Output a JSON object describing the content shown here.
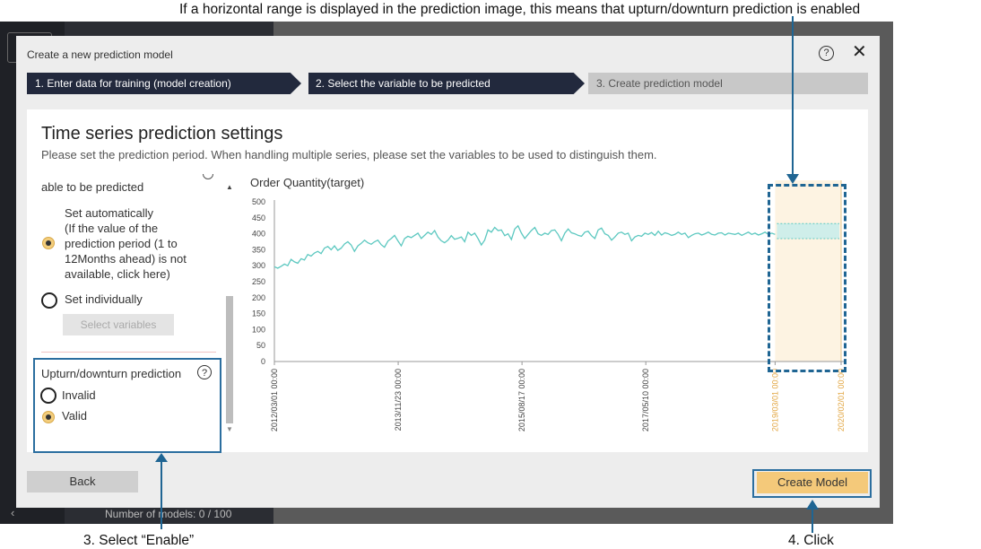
{
  "annotations": {
    "top_note": "If a horizontal range is displayed in the prediction image, this means that upturn/downturn prediction is enabled",
    "step3_caption": "3. Select “Enable”",
    "step4_caption": "4. Click"
  },
  "background": {
    "model_count": "Number of models: 0 / 100"
  },
  "dialog": {
    "title": "Create a new prediction model",
    "help_icon": "?",
    "close_icon": "✕",
    "steps": [
      {
        "label": "1. Enter data for training (model creation)",
        "state": "done"
      },
      {
        "label": "2. Select the variable to be predicted",
        "state": "current"
      },
      {
        "label": "3. Create prediction model",
        "state": "pending"
      }
    ],
    "panel": {
      "title": "Time series prediction settings",
      "description": "Please set the prediction period. When handling multiple series, please set the variables to be used to distinguish them."
    },
    "settings": {
      "section_label": "able to be predicted",
      "auto_option": {
        "lines": [
          "Set automatically",
          "(If the value of the",
          "prediction period (1 to",
          "12Months ahead) is not",
          "available, click here)"
        ],
        "checked": true
      },
      "individual_option": {
        "label": "Set individually",
        "checked": false
      },
      "select_variables_button": "Select variables",
      "upturn": {
        "label": "Upturn/downturn prediction",
        "help_icon": "?",
        "options": [
          {
            "label": "Invalid",
            "checked": false
          },
          {
            "label": "Valid",
            "checked": true
          }
        ]
      }
    },
    "buttons": {
      "back": "Back",
      "create": "Create Model"
    }
  },
  "colors": {
    "accent": "#f4c97a",
    "line": "#5cc8c0",
    "prediction_zone": "#fdf3e2",
    "highlight": "#1f6593",
    "step_active": "#22293d"
  },
  "chart_data": {
    "type": "line",
    "title": "Order Quantity(target)",
    "ylim": [
      0,
      500
    ],
    "yticks": [
      0,
      50,
      100,
      150,
      200,
      250,
      300,
      350,
      400,
      450,
      500
    ],
    "xtick_labels": [
      "2012/03/01 00:00",
      "2013/11/23 00:00",
      "2015/08/17 00:00",
      "2017/05/10 00:00",
      "2019/03/01 00:00",
      "2020/02/01 00:00"
    ],
    "x_start": "2012/03/01",
    "prediction_start": "2019/03/01",
    "prediction_end": "2020/02/01",
    "series": [
      {
        "values": [
          297,
          292,
          298,
          305,
          300,
          320,
          312,
          308,
          322,
          318,
          335,
          330,
          340,
          345,
          338,
          355,
          360,
          350,
          362,
          348,
          355,
          368,
          375,
          365,
          345,
          362,
          370,
          380,
          372,
          367,
          375,
          380,
          366,
          358,
          377,
          385,
          395,
          378,
          362,
          385,
          392,
          388,
          395,
          402,
          385,
          395,
          405,
          398,
          410,
          390,
          378,
          372,
          380,
          394,
          383,
          386,
          390,
          375,
          405,
          395,
          402,
          385,
          365,
          380,
          412,
          405,
          420,
          410,
          412,
          394,
          400,
          382,
          415,
          425,
          402,
          385,
          398,
          410,
          420,
          400,
          395,
          402,
          398,
          410,
          412,
          398,
          378,
          402,
          415,
          403,
          400,
          395,
          392,
          405,
          408,
          394,
          385,
          412,
          418,
          400,
          395,
          380,
          390,
          402,
          405,
          398,
          402,
          378,
          390,
          395,
          392,
          402,
          398,
          404,
          395,
          408,
          396,
          403,
          400,
          395,
          398,
          405,
          398,
          402,
          388,
          395,
          400,
          402,
          396,
          400,
          405,
          398,
          396,
          402,
          403,
          396,
          402,
          400,
          398,
          402,
          395,
          400,
          405,
          398,
          402,
          396,
          400,
          405,
          398,
          402,
          398
        ]
      }
    ],
    "prediction_range": {
      "low": 385,
      "high": 432
    }
  }
}
